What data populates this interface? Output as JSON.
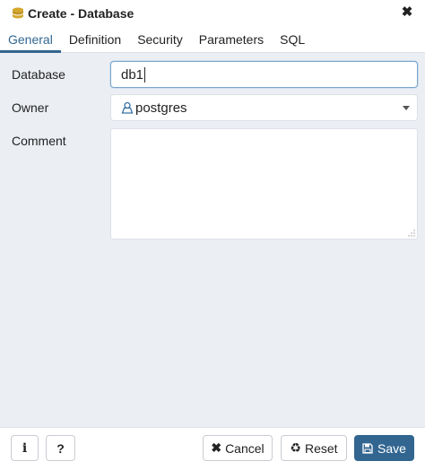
{
  "window": {
    "title": "Create - Database",
    "icon": "database-icon",
    "close_icon": "close-icon"
  },
  "tabs": [
    {
      "label": "General",
      "active": true
    },
    {
      "label": "Definition"
    },
    {
      "label": "Security"
    },
    {
      "label": "Parameters"
    },
    {
      "label": "SQL"
    }
  ],
  "form": {
    "database": {
      "label": "Database",
      "value": "db1"
    },
    "owner": {
      "label": "Owner",
      "value": "postgres",
      "icon": "user-icon"
    },
    "comment": {
      "label": "Comment",
      "value": ""
    }
  },
  "footer": {
    "info_label": "i",
    "help_label": "?",
    "cancel": {
      "icon": "✖",
      "label": "Cancel"
    },
    "reset": {
      "icon": "♻",
      "label": "Reset"
    },
    "save": {
      "icon": "save-icon",
      "label": "Save"
    }
  },
  "colors": {
    "accent": "#326690",
    "background": "#ebeef3",
    "border": "#dde0e6"
  }
}
